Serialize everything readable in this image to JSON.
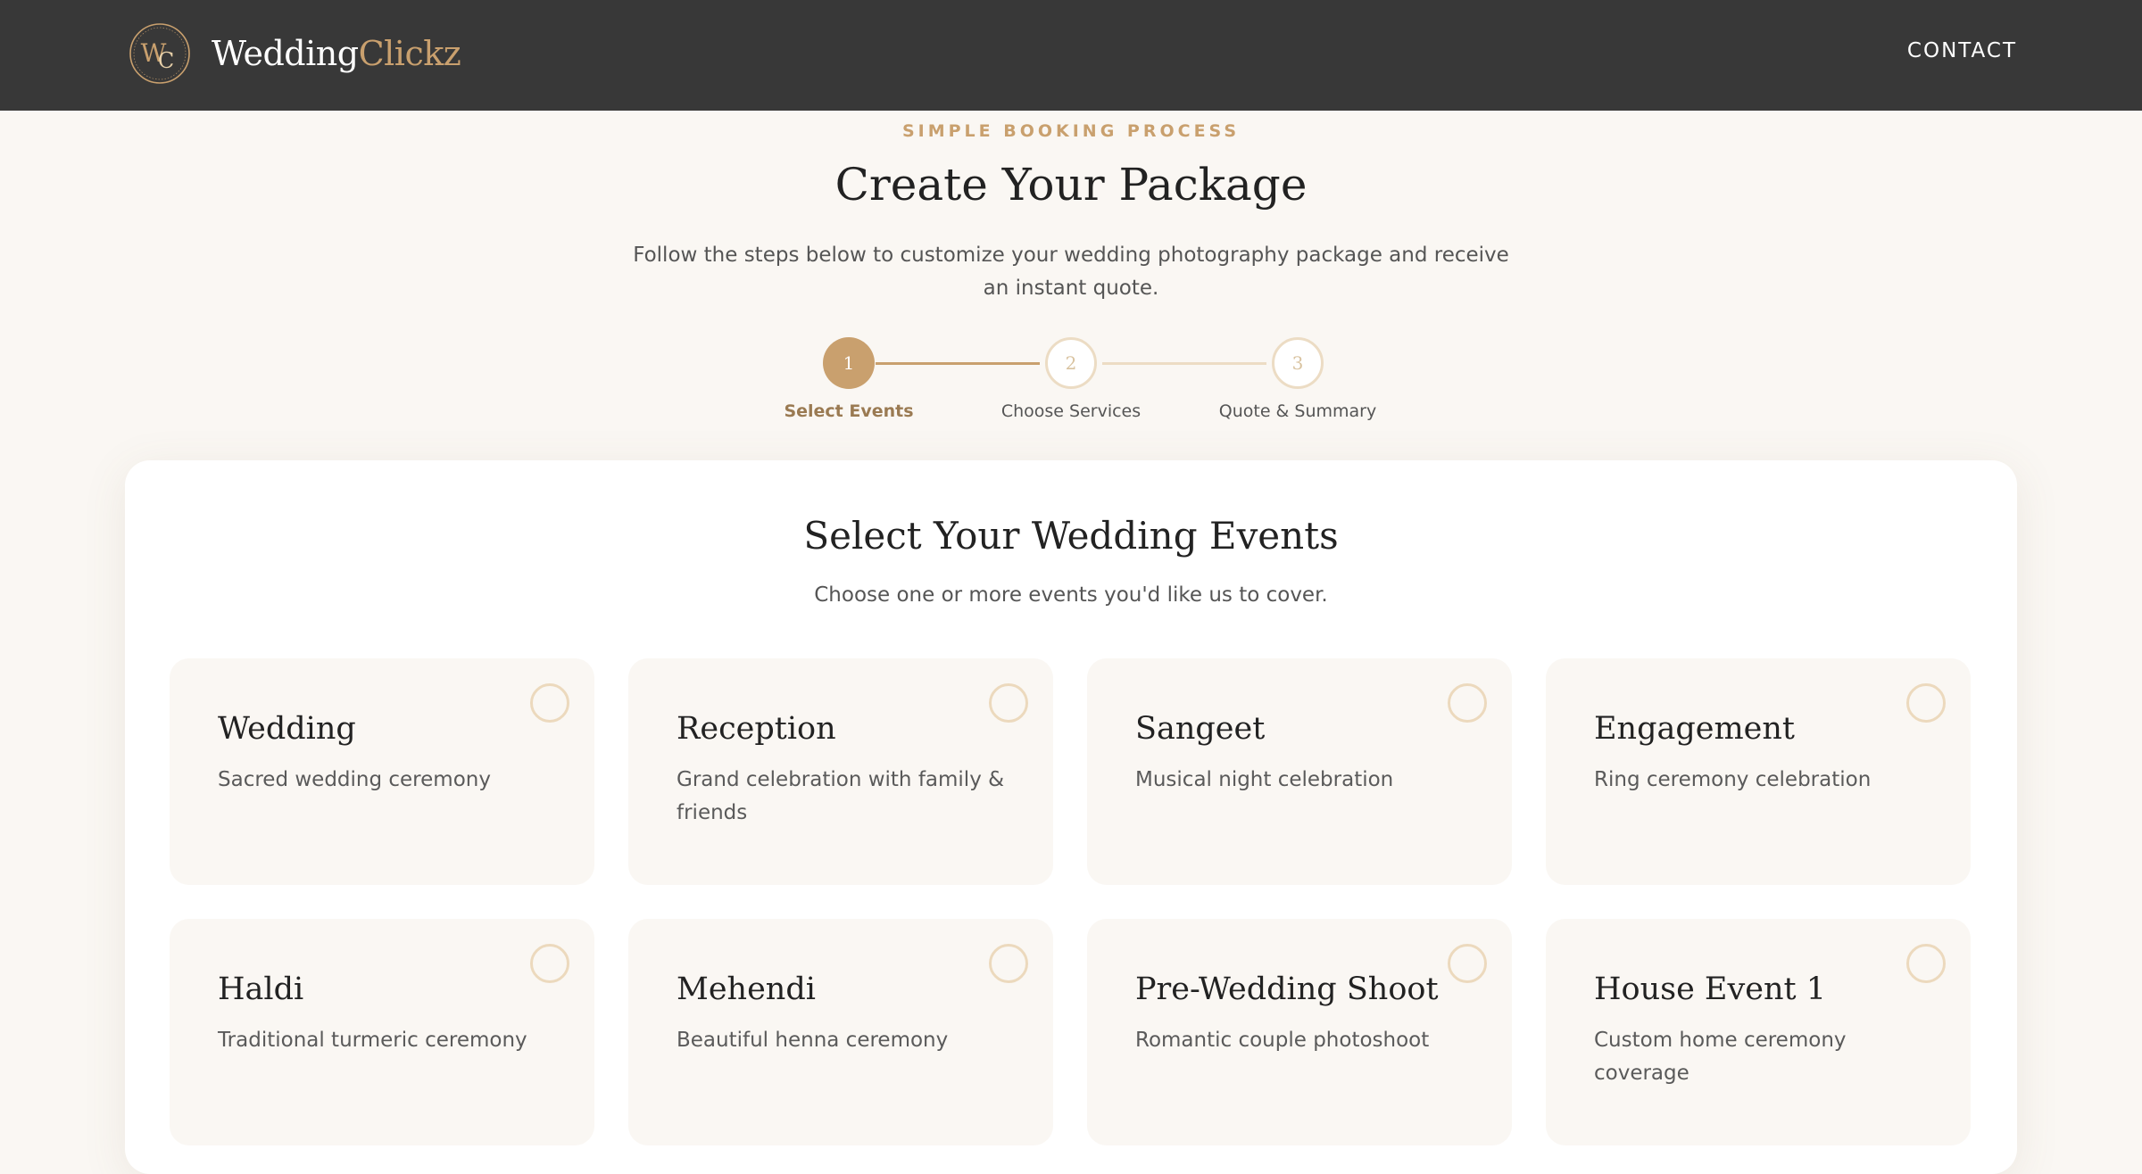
{
  "nav": {
    "brand_first": "Wedding",
    "brand_second": "Clickz",
    "logo_monogram": "WC",
    "contact_label": "CONTACT"
  },
  "hero": {
    "eyebrow": "SIMPLE BOOKING PROCESS",
    "title": "Create Your Package",
    "subtitle": "Follow the steps below to customize your wedding photography package and receive an instant quote."
  },
  "steps": [
    {
      "number": "1",
      "label": "Select Events",
      "state": "active"
    },
    {
      "number": "2",
      "label": "Choose Services",
      "state": "inactive"
    },
    {
      "number": "3",
      "label": "Quote & Summary",
      "state": "inactive"
    }
  ],
  "events_section": {
    "title": "Select Your Wedding Events",
    "subtitle": "Choose one or more events you'd like us to cover.",
    "items": [
      {
        "name": "Wedding",
        "description": "Sacred wedding ceremony",
        "selected": false
      },
      {
        "name": "Reception",
        "description": "Grand celebration with family & friends",
        "selected": false
      },
      {
        "name": "Sangeet",
        "description": "Musical night celebration",
        "selected": false
      },
      {
        "name": "Engagement",
        "description": "Ring ceremony celebration",
        "selected": false
      },
      {
        "name": "Haldi",
        "description": "Traditional turmeric ceremony",
        "selected": false
      },
      {
        "name": "Mehendi",
        "description": "Beautiful henna ceremony",
        "selected": false
      },
      {
        "name": "Pre-Wedding Shoot",
        "description": "Romantic couple photoshoot",
        "selected": false
      },
      {
        "name": "House Event 1",
        "description": "Custom home ceremony coverage",
        "selected": false
      }
    ]
  },
  "colors": {
    "nav_bg": "#383838",
    "accent": "#c9a06e",
    "page_bg": "#faf7f3",
    "card_bg": "#ffffff"
  },
  "icons": {
    "logo": "wc-monogram-logo-icon",
    "radio": "radio-circle-icon"
  }
}
